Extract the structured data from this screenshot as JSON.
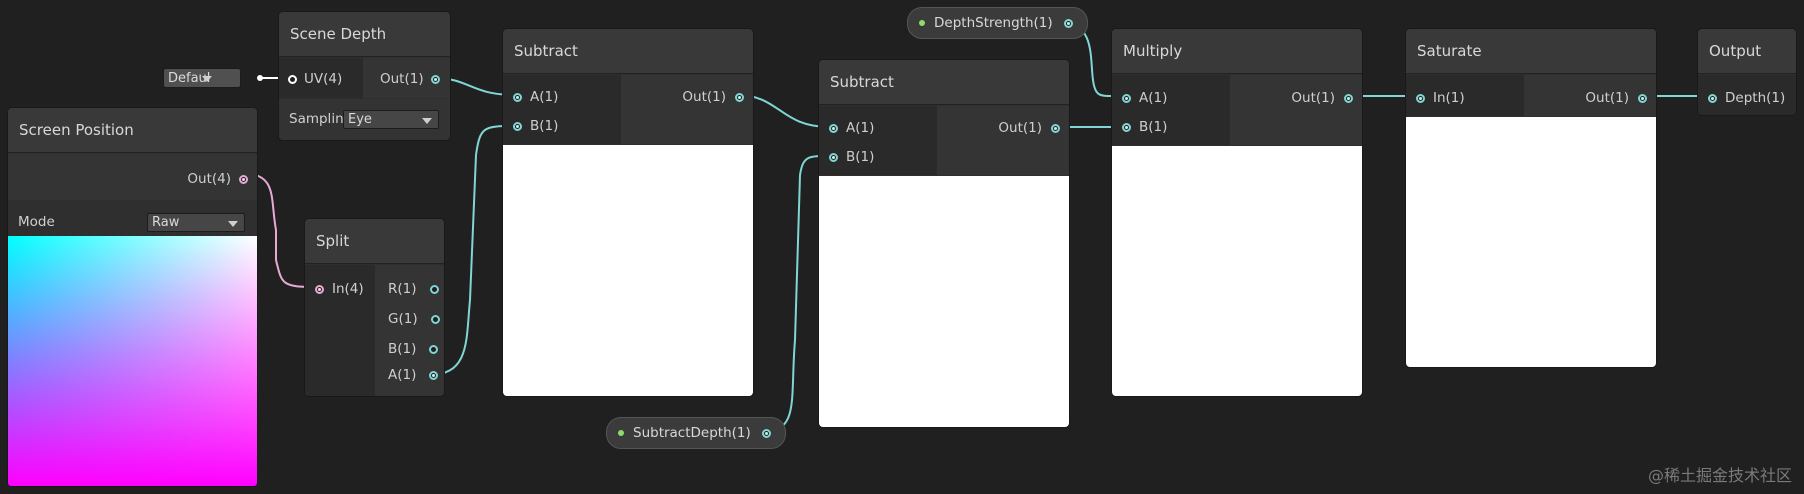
{
  "colors": {
    "background": "#202020",
    "wire_float": "#7fd6d3",
    "wire_vector4": "#e8aad4",
    "property_dot": "#8fdc6a"
  },
  "uv_default": {
    "label": "Defaul"
  },
  "nodes": {
    "scene_depth": {
      "title": "Scene Depth",
      "in_uv": "UV(4)",
      "out": "Out(1)",
      "sampling_label": "Samplin",
      "sampling_value": "Eye"
    },
    "screen_position": {
      "title": "Screen Position",
      "out": "Out(4)",
      "mode_label": "Mode",
      "mode_value": "Raw"
    },
    "split": {
      "title": "Split",
      "in": "In(4)",
      "outs": [
        "R(1)",
        "G(1)",
        "B(1)",
        "A(1)"
      ]
    },
    "subtract1": {
      "title": "Subtract",
      "in_a": "A(1)",
      "in_b": "B(1)",
      "out": "Out(1)"
    },
    "subtract2": {
      "title": "Subtract",
      "in_a": "A(1)",
      "in_b": "B(1)",
      "out": "Out(1)"
    },
    "multiply": {
      "title": "Multiply",
      "in_a": "A(1)",
      "in_b": "B(1)",
      "out": "Out(1)"
    },
    "saturate": {
      "title": "Saturate",
      "in": "In(1)",
      "out": "Out(1)"
    },
    "output": {
      "title": "Output",
      "in": "Depth(1)"
    }
  },
  "properties": {
    "depth_strength": "DepthStrength(1)",
    "subtract_depth": "SubtractDepth(1)"
  },
  "watermark": "@稀土掘金技术社区"
}
